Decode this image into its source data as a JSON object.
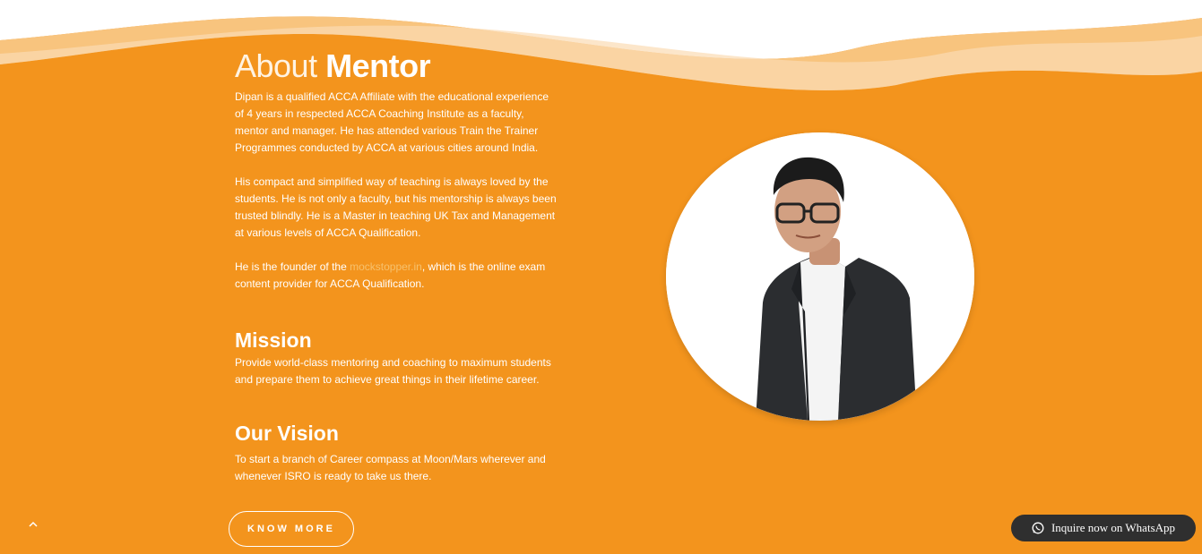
{
  "about": {
    "heading_light": "About",
    "heading_bold": "Mentor",
    "para1": "Dipan is a qualified ACCA Affiliate with the educational experience of 4 years in respected ACCA Coaching Institute as a faculty, mentor and manager. He has attended various Train the Trainer Programmes conducted by ACCA at various cities around India.",
    "para2": "His compact and simplified way of teaching is always loved by the students. He is not only a faculty, but his mentorship is always been trusted blindly. He is a Master in teaching UK Tax and Management at various levels of ACCA Qualification.",
    "para3_prefix": "He is the founder of the ",
    "para3_link": "mockstopper.in",
    "para3_suffix": ", which is the online exam content provider for ACCA Qualification."
  },
  "mission": {
    "title": "Mission",
    "text": "Provide world-class mentoring and coaching to maximum students and prepare them to achieve great things in their lifetime career."
  },
  "vision": {
    "title": "Our Vision",
    "text": "To start a branch of Career compass at Moon/Mars wherever and whenever ISRO is ready to take us there."
  },
  "cta": {
    "know_more": "KNOW MORE"
  },
  "floating": {
    "scroll_top_icon": "chevron-up-icon",
    "whatsapp_label": "Inquire now on WhatsApp",
    "whatsapp_icon": "whatsapp-icon"
  },
  "colors": {
    "background": "#f3941d",
    "text": "#ffffff",
    "whatsapp_bg": "#2f2f2f"
  }
}
